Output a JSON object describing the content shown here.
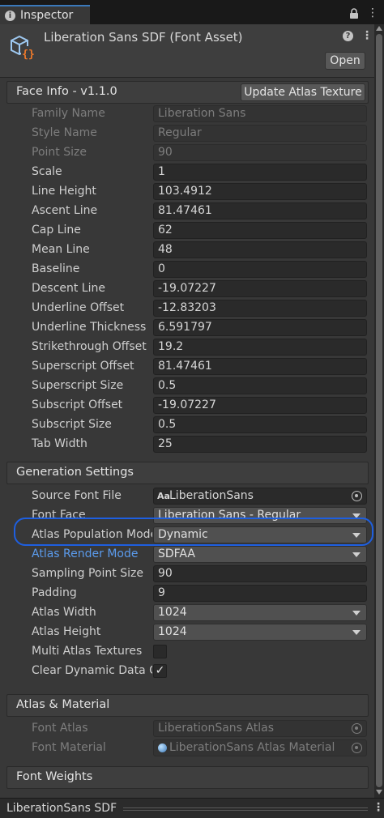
{
  "tab": {
    "label": "Inspector",
    "info_icon": "info-icon",
    "lock_icon": "lock-icon",
    "menu_icon": "menu-icon"
  },
  "header": {
    "title": "Liberation Sans SDF (Font Asset)",
    "icon": "font-asset-icon",
    "open_label": "Open"
  },
  "face_info": {
    "title": "Face Info - v1.1.0",
    "update_label": "Update Atlas Texture",
    "rows": [
      {
        "label": "Family Name",
        "value": "Liberation Sans",
        "disabled": true
      },
      {
        "label": "Style Name",
        "value": "Regular",
        "disabled": true
      },
      {
        "label": "Point Size",
        "value": "90",
        "disabled": true
      },
      {
        "label": "Scale",
        "value": "1"
      },
      {
        "label": "Line Height",
        "value": "103.4912"
      },
      {
        "label": "Ascent Line",
        "value": "81.47461"
      },
      {
        "label": "Cap Line",
        "value": "62"
      },
      {
        "label": "Mean Line",
        "value": "48"
      },
      {
        "label": "Baseline",
        "value": "0"
      },
      {
        "label": "Descent Line",
        "value": "-19.07227"
      },
      {
        "label": "Underline Offset",
        "value": "-12.83203"
      },
      {
        "label": "Underline Thickness",
        "value": "6.591797"
      },
      {
        "label": "Strikethrough Offset",
        "value": "19.2"
      },
      {
        "label": "Superscript Offset",
        "value": "81.47461"
      },
      {
        "label": "Superscript Size",
        "value": "0.5"
      },
      {
        "label": "Subscript Offset",
        "value": "-19.07227"
      },
      {
        "label": "Subscript Size",
        "value": "0.5"
      },
      {
        "label": "Tab Width",
        "value": "25"
      }
    ]
  },
  "generation": {
    "title": "Generation Settings",
    "source_font_file": {
      "label": "Source Font File",
      "value": "LiberationSans",
      "icon_text": "Aa"
    },
    "font_face": {
      "label": "Font Face",
      "value": "Liberation Sans - Regular"
    },
    "atlas_population_mode": {
      "label": "Atlas Population Mode",
      "value": "Dynamic"
    },
    "atlas_render_mode": {
      "label": "Atlas Render Mode",
      "value": "SDFAA"
    },
    "sampling_point_size": {
      "label": "Sampling Point Size",
      "value": "90"
    },
    "padding": {
      "label": "Padding",
      "value": "9"
    },
    "atlas_width": {
      "label": "Atlas Width",
      "value": "1024"
    },
    "atlas_height": {
      "label": "Atlas Height",
      "value": "1024"
    },
    "multi_atlas": {
      "label": "Multi Atlas Textures",
      "checked": false
    },
    "clear_dynamic": {
      "label": "Clear Dynamic Data On Build",
      "checked": true,
      "check_glyph": "✓"
    }
  },
  "atlas_material": {
    "title": "Atlas & Material",
    "font_atlas": {
      "label": "Font Atlas",
      "value": "LiberationSans Atlas"
    },
    "font_material": {
      "label": "Font Material",
      "value": "LiberationSans Atlas Material"
    }
  },
  "font_weights": {
    "title": "Font Weights"
  },
  "footer": {
    "label": "LiberationSans SDF"
  },
  "colors": {
    "accent": "#3a79bb",
    "highlight": "#1e5fe0",
    "active_label": "#5b9bec"
  }
}
